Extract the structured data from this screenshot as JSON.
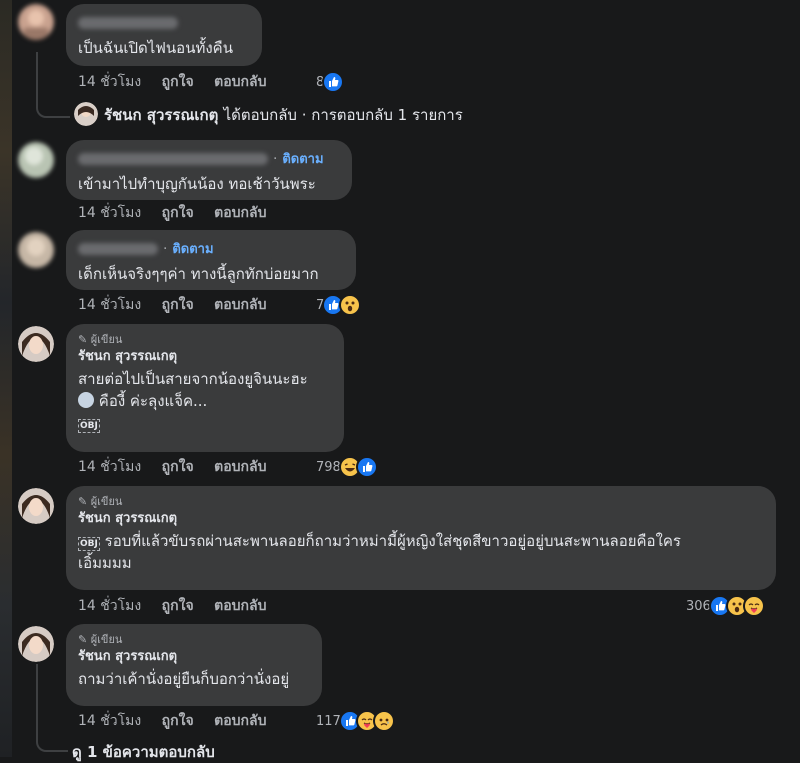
{
  "comments": [
    {
      "author": "",
      "text": "เป็นฉันเปิดไฟนอนทั้งคืน",
      "time": "14 ชั่วโมง",
      "like_action": "ถูกใจ",
      "reply_action": "ตอบกลับ",
      "reaction_count": "8",
      "reactions": [
        "like-icon"
      ]
    },
    {
      "author": "",
      "follow": "ติดตาม",
      "text": "เข้ามาไปทำบุญกันน้อง ทอเช้าวันพระ",
      "time": "14 ชั่วโมง",
      "like_action": "ถูกใจ",
      "reply_action": "ตอบกลับ"
    },
    {
      "author": "",
      "follow": "ติดตาม",
      "text": "เด็กเห็นจริงๆๆค่า ทางนี้ลูกทักบ่อยมาก",
      "time": "14 ชั่วโมง",
      "like_action": "ถูกใจ",
      "reply_action": "ตอบกลับ",
      "reaction_count": "7",
      "reactions": [
        "like-icon",
        "wow-icon"
      ]
    },
    {
      "badge": "ผู้เขียน",
      "author": "รัชนก สุวรรณเกตุ",
      "line1": "สายต่อไปเป็นสายจากน้องยูจินนะฮะ",
      "line2": "คืองี้ ค่ะลุงแจ็ค...",
      "tag": "OBJ",
      "time": "14 ชั่วโมง",
      "like_action": "ถูกใจ",
      "reply_action": "ตอบกลับ",
      "reaction_count": "798",
      "reactions": [
        "haha-icon",
        "like-icon"
      ]
    },
    {
      "badge": "ผู้เขียน",
      "author": "รัชนก สุวรรณเกตุ",
      "tag": "OBJ",
      "line1": "รอบที่แล้วขับรถผ่านสะพานลอยก็ถามว่าหม่ามี้ผู้หญิงใส่ชุดสีขาวอยู่อยู่บนสะพานลอยคือใคร",
      "line2": "เอิ้มมมม",
      "time": "14 ชั่วโมง",
      "like_action": "ถูกใจ",
      "reply_action": "ตอบกลับ",
      "reaction_count": "306",
      "reactions": [
        "like-icon",
        "wow-icon",
        "care-icon"
      ]
    },
    {
      "badge": "ผู้เขียน",
      "author": "รัชนก สุวรรณเกตุ",
      "text": "ถามว่าเค้านั่งอยู่ยืนก็บอกว่านั่งอยู่",
      "time": "14 ชั่วโมง",
      "like_action": "ถูกใจ",
      "reply_action": "ตอบกลับ",
      "reaction_count": "117",
      "reactions": [
        "like-icon",
        "care-icon",
        "sad-icon"
      ]
    }
  ],
  "reply_summary": {
    "name": "รัชนก สุวรรณเกตุ",
    "text": "ได้ตอบกลับ · การตอบกลับ 1 รายการ"
  },
  "more_replies": "ดู 1 ข้อความตอบกลับ",
  "colors": {
    "background": "#18191a",
    "bubble": "#3a3b3c",
    "link": "#6ab0ff",
    "like": "#1877f2",
    "reaction_yellow": "#f7c34b"
  }
}
